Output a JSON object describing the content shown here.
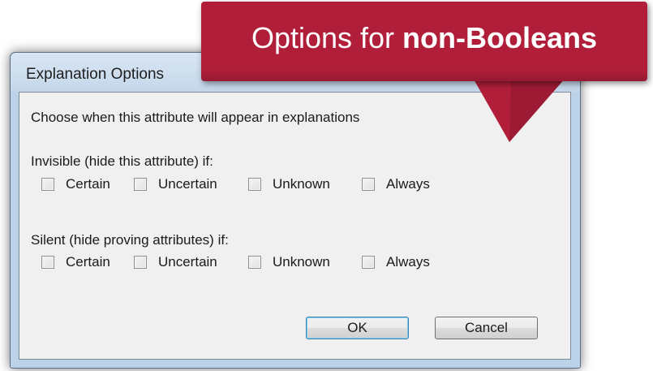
{
  "dialog": {
    "title": "Explanation Options",
    "intro": "Choose when this attribute will appear in explanations",
    "invisible": {
      "label": "Invisible (hide this attribute) if:",
      "options": [
        "Certain",
        "Uncertain",
        "Unknown",
        "Always"
      ]
    },
    "silent": {
      "label": "Silent (hide proving attributes) if:",
      "options": [
        "Certain",
        "Uncertain",
        "Unknown",
        "Always"
      ]
    },
    "ok_label": "OK",
    "cancel_label": "Cancel"
  },
  "callout": {
    "prefix": "Options for",
    "emphasis": "non-Booleans",
    "color": "#b01e3a"
  },
  "checkbox_states": {
    "invisible": [
      false,
      false,
      false,
      false
    ],
    "silent": [
      false,
      false,
      false,
      false
    ]
  }
}
